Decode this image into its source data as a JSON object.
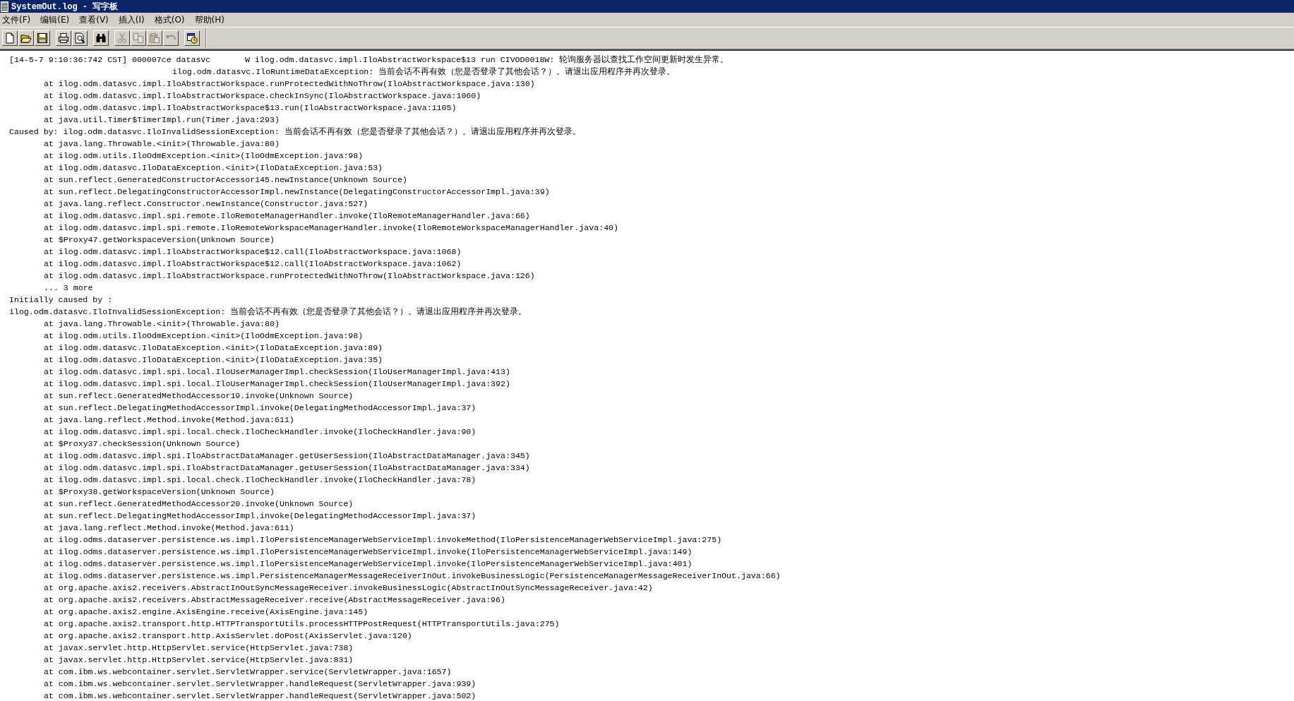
{
  "window": {
    "title": "SystemOut.log - 写字板"
  },
  "menu": [
    {
      "label": "文件(F)"
    },
    {
      "label": "编辑(E)"
    },
    {
      "label": "查看(V)"
    },
    {
      "label": "插入(I)"
    },
    {
      "label": "格式(O)"
    },
    {
      "label": "帮助(H)"
    }
  ],
  "toolbar": [
    [
      {
        "kind": "new",
        "disabled": false
      },
      {
        "kind": "open",
        "disabled": false
      },
      {
        "kind": "save",
        "disabled": false
      }
    ],
    [
      {
        "kind": "print",
        "disabled": false
      },
      {
        "kind": "preview",
        "disabled": false
      }
    ],
    [
      {
        "kind": "find",
        "disabled": false
      }
    ],
    [
      {
        "kind": "cut",
        "disabled": true
      },
      {
        "kind": "copy",
        "disabled": true
      },
      {
        "kind": "paste",
        "disabled": true
      },
      {
        "kind": "undo",
        "disabled": true
      }
    ],
    [
      {
        "kind": "datetime",
        "disabled": false
      }
    ]
  ],
  "document": {
    "lines": [
      {
        "kind": "plain",
        "text": "[14-5-7 9:10:36:742 CST] 000007ce datasvc       W ilog.odm.datasvc.impl.IloAbstractWorkspace$13 run CIVOD0018W: 轮询服务器以查找工作空间更新时发生异常。"
      },
      {
        "kind": "continuation",
        "text": "ilog.odm.datasvc.IloRuntimeDataException: 当前会话不再有效（您是否登录了其他会话？）。请退出应用程序并再次登录。"
      },
      {
        "kind": "frame",
        "text": "at ilog.odm.datasvc.impl.IloAbstractWorkspace.runProtectedWithNoThrow(IloAbstractWorkspace.java:130)"
      },
      {
        "kind": "frame",
        "text": "at ilog.odm.datasvc.impl.IloAbstractWorkspace.checkInSync(IloAbstractWorkspace.java:1060)"
      },
      {
        "kind": "frame",
        "text": "at ilog.odm.datasvc.impl.IloAbstractWorkspace$13.run(IloAbstractWorkspace.java:1105)"
      },
      {
        "kind": "frame",
        "text": "at java.util.Timer$TimerImpl.run(Timer.java:293)"
      },
      {
        "kind": "plain",
        "text": "Caused by: ilog.odm.datasvc.IloInvalidSessionException: 当前会话不再有效（您是否登录了其他会话？）。请退出应用程序并再次登录。"
      },
      {
        "kind": "frame",
        "text": "at java.lang.Throwable.<init>(Throwable.java:80)"
      },
      {
        "kind": "frame",
        "text": "at ilog.odm.utils.IloOdmException.<init>(IloOdmException.java:98)"
      },
      {
        "kind": "frame",
        "text": "at ilog.odm.datasvc.IloDataException.<init>(IloDataException.java:53)"
      },
      {
        "kind": "frame",
        "text": "at sun.reflect.GeneratedConstructorAccessor145.newInstance(Unknown Source)"
      },
      {
        "kind": "frame",
        "text": "at sun.reflect.DelegatingConstructorAccessorImpl.newInstance(DelegatingConstructorAccessorImpl.java:39)"
      },
      {
        "kind": "frame",
        "text": "at java.lang.reflect.Constructor.newInstance(Constructor.java:527)"
      },
      {
        "kind": "frame",
        "text": "at ilog.odm.datasvc.impl.spi.remote.IloRemoteManagerHandler.invoke(IloRemoteManagerHandler.java:66)"
      },
      {
        "kind": "frame",
        "text": "at ilog.odm.datasvc.impl.spi.remote.IloRemoteWorkspaceManagerHandler.invoke(IloRemoteWorkspaceManagerHandler.java:40)"
      },
      {
        "kind": "frame",
        "text": "at $Proxy47.getWorkspaceVersion(Unknown Source)"
      },
      {
        "kind": "frame",
        "text": "at ilog.odm.datasvc.impl.IloAbstractWorkspace$12.call(IloAbstractWorkspace.java:1068)"
      },
      {
        "kind": "frame",
        "text": "at ilog.odm.datasvc.impl.IloAbstractWorkspace$12.call(IloAbstractWorkspace.java:1062)"
      },
      {
        "kind": "frame",
        "text": "at ilog.odm.datasvc.impl.IloAbstractWorkspace.runProtectedWithNoThrow(IloAbstractWorkspace.java:126)"
      },
      {
        "kind": "frame",
        "text": "... 3 more"
      },
      {
        "kind": "plain",
        "text": "Initially caused by :"
      },
      {
        "kind": "plain",
        "text": "ilog.odm.datasvc.IloInvalidSessionException: 当前会话不再有效（您是否登录了其他会话？）。请退出应用程序并再次登录。"
      },
      {
        "kind": "frame",
        "text": "at java.lang.Throwable.<init>(Throwable.java:80)"
      },
      {
        "kind": "frame",
        "text": "at ilog.odm.utils.IloOdmException.<init>(IloOdmException.java:98)"
      },
      {
        "kind": "frame",
        "text": "at ilog.odm.datasvc.IloDataException.<init>(IloDataException.java:89)"
      },
      {
        "kind": "frame",
        "text": "at ilog.odm.datasvc.IloDataException.<init>(IloDataException.java:35)"
      },
      {
        "kind": "frame",
        "text": "at ilog.odm.datasvc.impl.spi.local.IloUserManagerImpl.checkSession(IloUserManagerImpl.java:413)"
      },
      {
        "kind": "frame",
        "text": "at ilog.odm.datasvc.impl.spi.local.IloUserManagerImpl.checkSession(IloUserManagerImpl.java:392)"
      },
      {
        "kind": "frame",
        "text": "at sun.reflect.GeneratedMethodAccessor19.invoke(Unknown Source)"
      },
      {
        "kind": "frame",
        "text": "at sun.reflect.DelegatingMethodAccessorImpl.invoke(DelegatingMethodAccessorImpl.java:37)"
      },
      {
        "kind": "frame",
        "text": "at java.lang.reflect.Method.invoke(Method.java:611)"
      },
      {
        "kind": "frame",
        "text": "at ilog.odm.datasvc.impl.spi.local.check.IloCheckHandler.invoke(IloCheckHandler.java:90)"
      },
      {
        "kind": "frame",
        "text": "at $Proxy37.checkSession(Unknown Source)"
      },
      {
        "kind": "frame",
        "text": "at ilog.odm.datasvc.impl.spi.IloAbstractDataManager.getUserSession(IloAbstractDataManager.java:345)"
      },
      {
        "kind": "frame",
        "text": "at ilog.odm.datasvc.impl.spi.IloAbstractDataManager.getUserSession(IloAbstractDataManager.java:334)"
      },
      {
        "kind": "frame",
        "text": "at ilog.odm.datasvc.impl.spi.local.check.IloCheckHandler.invoke(IloCheckHandler.java:78)"
      },
      {
        "kind": "frame",
        "text": "at $Proxy38.getWorkspaceVersion(Unknown Source)"
      },
      {
        "kind": "frame",
        "text": "at sun.reflect.GeneratedMethodAccessor20.invoke(Unknown Source)"
      },
      {
        "kind": "frame",
        "text": "at sun.reflect.DelegatingMethodAccessorImpl.invoke(DelegatingMethodAccessorImpl.java:37)"
      },
      {
        "kind": "frame",
        "text": "at java.lang.reflect.Method.invoke(Method.java:611)"
      },
      {
        "kind": "frame",
        "text": "at ilog.odms.dataserver.persistence.ws.impl.IloPersistenceManagerWebServiceImpl.invokeMethod(IloPersistenceManagerWebServiceImpl.java:275)"
      },
      {
        "kind": "frame",
        "text": "at ilog.odms.dataserver.persistence.ws.impl.IloPersistenceManagerWebServiceImpl.invoke(IloPersistenceManagerWebServiceImpl.java:149)"
      },
      {
        "kind": "frame",
        "text": "at ilog.odms.dataserver.persistence.ws.impl.IloPersistenceManagerWebServiceImpl.invoke(IloPersistenceManagerWebServiceImpl.java:401)"
      },
      {
        "kind": "frame",
        "text": "at ilog.odms.dataserver.persistence.ws.impl.PersistenceManagerMessageReceiverInOut.invokeBusinessLogic(PersistenceManagerMessageReceiverInOut.java:66)"
      },
      {
        "kind": "frame",
        "text": "at org.apache.axis2.receivers.AbstractInOutSyncMessageReceiver.invokeBusinessLogic(AbstractInOutSyncMessageReceiver.java:42)"
      },
      {
        "kind": "frame",
        "text": "at org.apache.axis2.receivers.AbstractMessageReceiver.receive(AbstractMessageReceiver.java:96)"
      },
      {
        "kind": "frame",
        "text": "at org.apache.axis2.engine.AxisEngine.receive(AxisEngine.java:145)"
      },
      {
        "kind": "frame",
        "text": "at org.apache.axis2.transport.http.HTTPTransportUtils.processHTTPPostRequest(HTTPTransportUtils.java:275)"
      },
      {
        "kind": "frame",
        "text": "at org.apache.axis2.transport.http.AxisServlet.doPost(AxisServlet.java:120)"
      },
      {
        "kind": "frame",
        "text": "at javax.servlet.http.HttpServlet.service(HttpServlet.java:738)"
      },
      {
        "kind": "frame",
        "text": "at javax.servlet.http.HttpServlet.service(HttpServlet.java:831)"
      },
      {
        "kind": "frame",
        "text": "at com.ibm.ws.webcontainer.servlet.ServletWrapper.service(ServletWrapper.java:1657)"
      },
      {
        "kind": "frame",
        "text": "at com.ibm.ws.webcontainer.servlet.ServletWrapper.handleRequest(ServletWrapper.java:939)"
      },
      {
        "kind": "frame",
        "text": "at com.ibm.ws.webcontainer.servlet.ServletWrapper.handleRequest(ServletWrapper.java:502)"
      }
    ]
  }
}
